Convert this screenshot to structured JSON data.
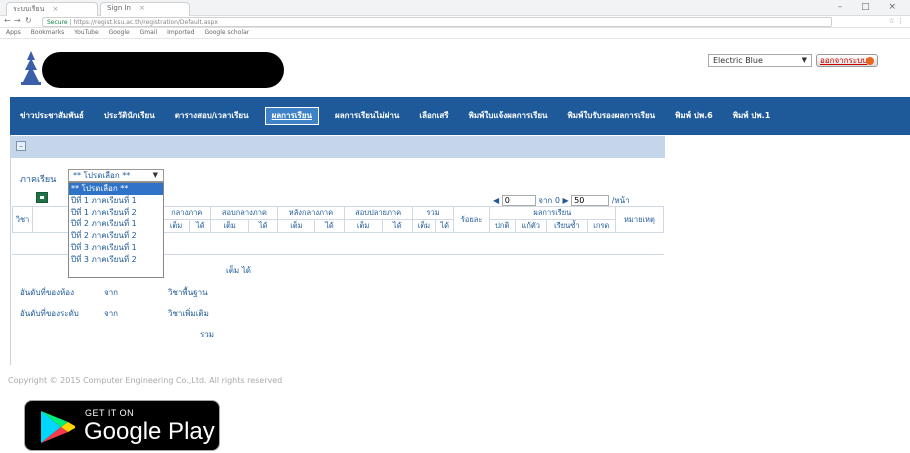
{
  "browser": {
    "tabs": [
      {
        "label": "ระบบเรียน"
      },
      {
        "label": "Sign In"
      }
    ],
    "window_controls": "– □ ×",
    "url_secure": "Secure",
    "url": "https://regist.ksu.ac.th/registration/Default.aspx",
    "bookmarks": [
      "Apps",
      "Bookmarks",
      "YouTube",
      "Google",
      "Gmail",
      "Imported",
      "Google scholar"
    ]
  },
  "header": {
    "theme_select": {
      "value": "Electric Blue"
    },
    "logout_label": "ออกจากระบบ"
  },
  "nav": {
    "items": [
      {
        "label": "ข่าวประชาสัมพันธ์"
      },
      {
        "label": "ประวัตินักเรียน"
      },
      {
        "label": "ตารางสอบ/เวลาเรียน"
      },
      {
        "label": "ผลการเรียน"
      },
      {
        "label": "ผลการเรียนไม่ผ่าน"
      },
      {
        "label": "เลือกเสรี"
      },
      {
        "label": "พิมพ์ใบแจ้งผลการเรียน"
      },
      {
        "label": "พิมพ์ใบรับรองผลการเรียน"
      },
      {
        "label": "พิมพ์ ปพ.6"
      },
      {
        "label": "พิมพ์ ปพ.1"
      }
    ],
    "active_index": 3
  },
  "content": {
    "term_label": "ภาคเรียน",
    "term_select": {
      "value": "** โปรดเลือก **",
      "options": [
        "** โปรดเลือก **",
        "ปีที่ 1 ภาคเรียนที่ 1",
        "ปีที่ 1 ภาคเรียนที่ 2",
        "ปีที่ 2 ภาคเรียนที่ 1",
        "ปีที่ 2 ภาคเรียนที่ 2",
        "ปีที่ 3 ภาคเรียนที่ 1",
        "ปีที่ 3 ภาคเรียนที่ 2"
      ]
    },
    "pager": {
      "page": "0",
      "of_text": "จาก 0",
      "per_page": "50",
      "per_page_suffix": "/หน้า"
    },
    "table": {
      "row1": [
        "วิชา",
        "ชื่อวิชา",
        "กลางภาค",
        "สอบกลางภาค",
        "หลังกลางภาค",
        "สอบปลายภาค",
        "รวม",
        "ร้อยละ",
        "ผลการเรียน",
        "หมายเหตุ"
      ],
      "row2": [
        "เต็ม",
        "ได้",
        "เต็ม",
        "ได้",
        "เต็ม",
        "ได้",
        "เต็ม",
        "ได้",
        "เต็ม",
        "ได้",
        "ปกติ",
        "แก้ตัว",
        "เรียนซ้ำ",
        "เกรด"
      ]
    },
    "summary": {
      "full_got": "เต็ม ได้",
      "rank1_label": "อันดับที่ของห้อง",
      "rank1_from": "จาก",
      "rank2_label": "อันดับที่ของระดับ",
      "rank2_from": "จาก",
      "basic_label": "วิชาพื้นฐาน",
      "extra_label": "วิชาเพิ่มเติม",
      "total_label": "รวม"
    }
  },
  "footer": {
    "copyright": "Copyright © 2015 Computer Engineering Co.,Ltd. All rights reserved",
    "gplay_small": "GET IT ON",
    "gplay_big": "Google Play"
  }
}
